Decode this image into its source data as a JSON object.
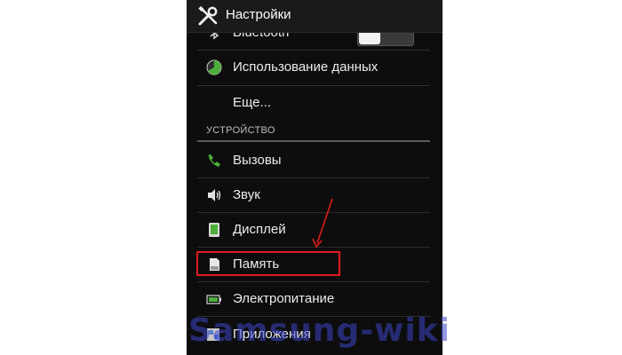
{
  "header": {
    "title": "Настройки",
    "icon": "settings-tools-icon"
  },
  "items": [
    {
      "label": "Bluetooth",
      "icon": "bluetooth-icon",
      "toggle": "on"
    },
    {
      "label": "Использование данных",
      "icon": "data-usage-icon"
    },
    {
      "label": "Еще...",
      "icon": ""
    }
  ],
  "section": {
    "title": "УСТРОЙСТВО"
  },
  "device_items": [
    {
      "label": "Вызовы",
      "icon": "phone-icon"
    },
    {
      "label": "Звук",
      "icon": "speaker-icon"
    },
    {
      "label": "Дисплей",
      "icon": "display-icon"
    },
    {
      "label": "Память",
      "icon": "sd-card-icon"
    },
    {
      "label": "Электропитание",
      "icon": "battery-icon"
    },
    {
      "label": "Приложения",
      "icon": "apps-icon"
    }
  ],
  "watermark": "Samsung-wiki",
  "colors": {
    "background": "#0d0d0d",
    "highlight": "#e21b1b",
    "green": "#4caf3a",
    "watermark": "#3c46c8"
  }
}
